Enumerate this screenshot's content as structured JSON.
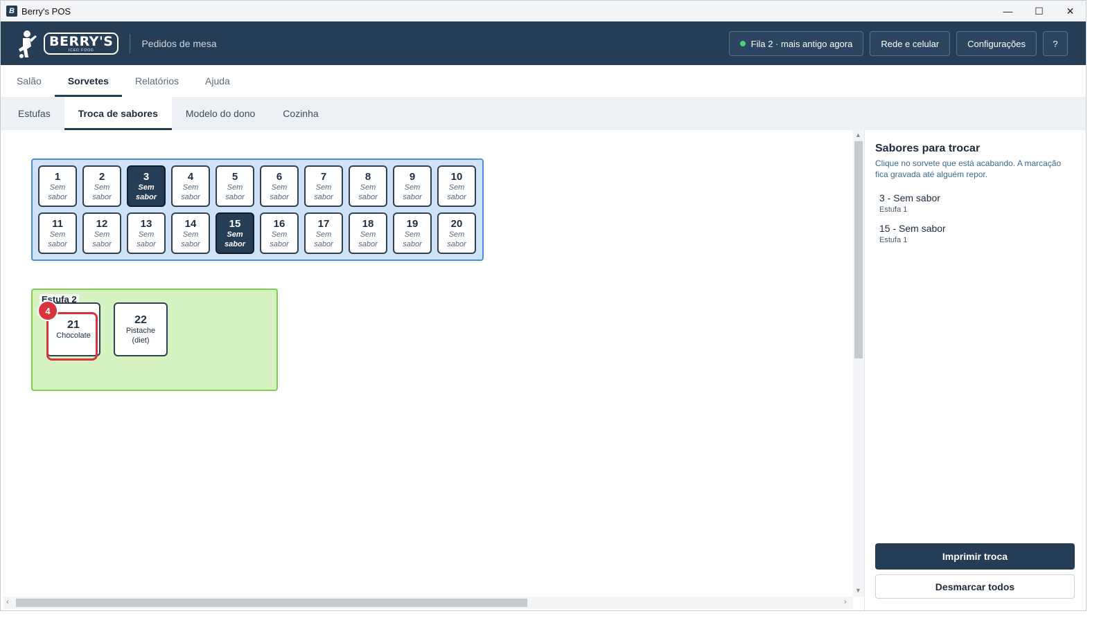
{
  "window": {
    "title": "Berry's POS",
    "app_icon": "pos-app-icon"
  },
  "header": {
    "logo_text": "BERRY'S",
    "logo_subtext": "ICED FOOD",
    "title": "Pedidos de mesa",
    "queue_status": "Fila 2 · mais antigo agora",
    "network_button": "Rede e celular",
    "settings_button": "Configurações",
    "help_button": "?"
  },
  "main_tabs": [
    "Salão",
    "Sorvetes",
    "Relatórios",
    "Ajuda"
  ],
  "main_tab_active": "Sorvetes",
  "sub_tabs": [
    "Estufas",
    "Troca de sabores",
    "Modelo do dono",
    "Cozinha"
  ],
  "sub_tab_active": "Troca de sabores",
  "estufa1": {
    "cells": [
      {
        "num": "1",
        "flavor": "Sem sabor"
      },
      {
        "num": "2",
        "flavor": "Sem sabor"
      },
      {
        "num": "3",
        "flavor": "Sem sabor"
      },
      {
        "num": "4",
        "flavor": "Sem sabor"
      },
      {
        "num": "5",
        "flavor": "Sem sabor"
      },
      {
        "num": "6",
        "flavor": "Sem sabor"
      },
      {
        "num": "7",
        "flavor": "Sem sabor"
      },
      {
        "num": "8",
        "flavor": "Sem sabor"
      },
      {
        "num": "9",
        "flavor": "Sem sabor"
      },
      {
        "num": "10",
        "flavor": "Sem sabor"
      },
      {
        "num": "11",
        "flavor": "Sem sabor"
      },
      {
        "num": "12",
        "flavor": "Sem sabor"
      },
      {
        "num": "13",
        "flavor": "Sem sabor"
      },
      {
        "num": "14",
        "flavor": "Sem sabor"
      },
      {
        "num": "15",
        "flavor": "Sem sabor"
      },
      {
        "num": "16",
        "flavor": "Sem sabor"
      },
      {
        "num": "17",
        "flavor": "Sem sabor"
      },
      {
        "num": "18",
        "flavor": "Sem sabor"
      },
      {
        "num": "19",
        "flavor": "Sem sabor"
      },
      {
        "num": "20",
        "flavor": "Sem sabor"
      }
    ],
    "selected": [
      "3",
      "15"
    ]
  },
  "estufa2": {
    "label": "Estufa 2",
    "cells": [
      {
        "num": "21",
        "flavor": "Chocolate"
      },
      {
        "num": "22",
        "flavor": "Pistache (diet)"
      }
    ],
    "badge": "4"
  },
  "panel": {
    "title": "Sabores para trocar",
    "description": "Clique no sorvete que está acabando. A marcação fica gravada até alguém repor.",
    "items": [
      {
        "name": "3 - Sem sabor",
        "location": "Estufa 1"
      },
      {
        "name": "15 - Sem sabor",
        "location": "Estufa 1"
      }
    ],
    "print_button": "Imprimir troca",
    "clear_button": "Desmarcar todos"
  },
  "colors": {
    "header_bg": "#253d55",
    "estufa1_bg": "#cfe2f7",
    "estufa1_border": "#4a90e2",
    "estufa2_bg": "#d5f2c0",
    "estufa2_border": "#7ed04a",
    "alert": "#d9343e",
    "status_ok": "#4ed07a"
  }
}
